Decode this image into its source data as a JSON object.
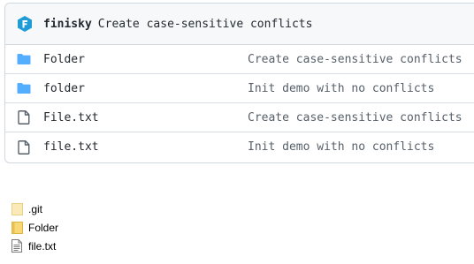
{
  "repo": {
    "latest_commit": {
      "author": "finisky",
      "message": "Create case-sensitive conflicts",
      "avatar_icon": "github-avatar-f-icon",
      "avatar_color": "#1f9bd8"
    },
    "files": [
      {
        "name": "Folder",
        "type": "directory",
        "icon": "folder-icon",
        "commit_message": "Create case-sensitive conflicts"
      },
      {
        "name": "folder",
        "type": "directory",
        "icon": "folder-icon",
        "commit_message": "Init demo with no conflicts"
      },
      {
        "name": "File.txt",
        "type": "file",
        "icon": "file-icon",
        "commit_message": "Create case-sensitive conflicts"
      },
      {
        "name": "file.txt",
        "type": "file",
        "icon": "file-icon",
        "commit_message": "Init demo with no conflicts"
      }
    ],
    "colors": {
      "folder_blue": "#54aeff",
      "header_bg": "#f6f8fa",
      "border": "#d0d7de"
    }
  },
  "local": {
    "items": [
      {
        "name": ".git",
        "icon": "hidden-folder-icon"
      },
      {
        "name": "Folder",
        "icon": "folder-icon"
      },
      {
        "name": "file.txt",
        "icon": "text-file-icon"
      }
    ],
    "colors": {
      "folder_yellow": "#f8d775",
      "hidden_folder": "#fbe9b7"
    }
  }
}
